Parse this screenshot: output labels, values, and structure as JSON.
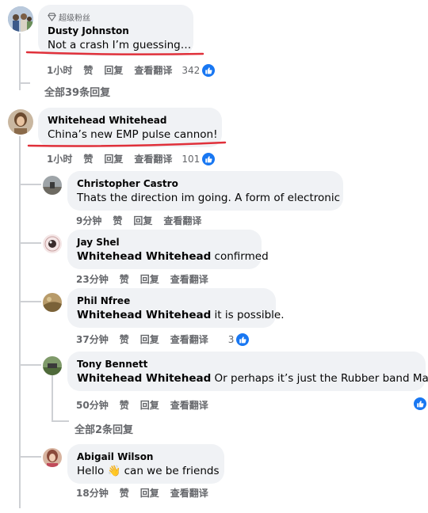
{
  "comments": [
    {
      "fan_badge": "超级粉丝",
      "author": "Dusty Johnston",
      "text": "Not a crash I’m guessing…",
      "time": "1小时",
      "like": "赞",
      "reply": "回复",
      "translate": "查看翻译",
      "likes": "342"
    },
    {
      "author": "Whitehead Whitehead",
      "text": "China’s new EMP pulse cannon!",
      "time": "1小时",
      "like": "赞",
      "reply": "回复",
      "translate": "查看翻译",
      "likes": "101"
    }
  ],
  "view_all_replies": "全部39条回复",
  "replies": [
    {
      "author": "Christopher Castro",
      "text": "Thats the direction im going. A form of electronic",
      "time": "9分钟",
      "like": "赞",
      "reply": "回复",
      "translate": "查看翻译"
    },
    {
      "author": "Jay Shel",
      "mention": "Whitehead Whitehead",
      "text": " confirmed",
      "time": "23分钟",
      "like": "赞",
      "reply": "回复",
      "translate": "查看翻译"
    },
    {
      "author": "Phil Nfree",
      "mention": "Whitehead Whitehead",
      "text": " it is possible.",
      "time": "37分钟",
      "like": "赞",
      "reply": "回复",
      "translate": "查看翻译",
      "likes": "3"
    },
    {
      "author": "Tony Bennett",
      "mention": "Whitehead Whitehead",
      "text": " Or perhaps it’s just the Rubber band Man.",
      "time": "50分钟",
      "like": "赞",
      "reply": "回复",
      "translate": "查看翻译"
    },
    {
      "author": "Abigail Wilson",
      "text_before": "Hello ",
      "emoji": "👋",
      "text_after": " can we be friends",
      "time": "18分钟",
      "like": "赞",
      "reply": "回复",
      "translate": "查看翻译"
    }
  ],
  "view_2_replies": "全部2条回复",
  "colors": {
    "like_blue": "#1877f2",
    "underline_red": "#e0303a",
    "bubble": "#f0f2f5",
    "meta": "#65676b"
  },
  "icons": {
    "like": "thumbs-up-icon",
    "fan": "diamond-icon"
  }
}
